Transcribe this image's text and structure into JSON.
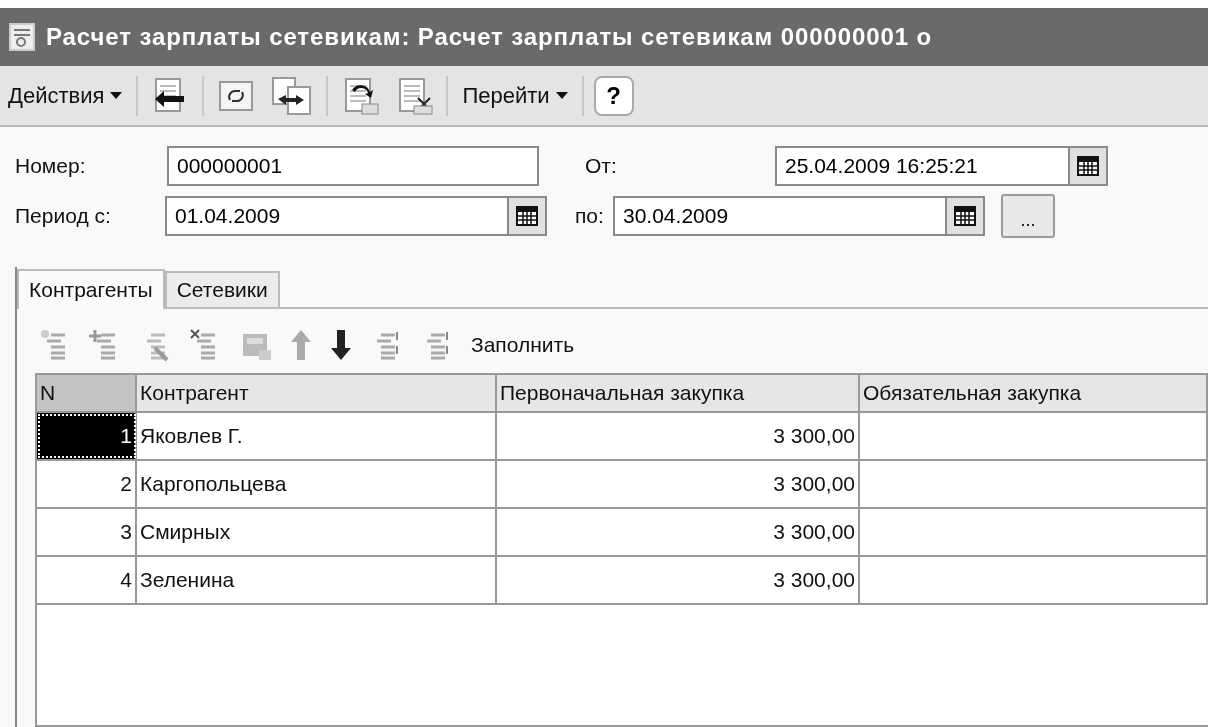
{
  "window": {
    "title": "Расчет зарплаты сетевикам: Расчет зарплаты сетевикам 000000001 о"
  },
  "toolbar": {
    "menus": [
      {
        "label": "Действия"
      },
      {
        "label": "Перейти"
      }
    ],
    "help": "?"
  },
  "header": {
    "number_label": "Номер:",
    "number": "000000001",
    "date_label": "От:",
    "date": "25.04.2009 16:25:21",
    "period_from_label": "Период с:",
    "period_from": "01.04.2009",
    "period_to_label": "по:",
    "period_to": "30.04.2009",
    "period_button": "..."
  },
  "tabs": [
    {
      "label": "Контрагенты",
      "selected": true
    },
    {
      "label": "Сетевики",
      "selected": false
    }
  ],
  "table_toolbar": {
    "fill_button": "Заполнить"
  },
  "table": {
    "columns": [
      "N",
      "Контрагент",
      "Первоначальная закупка",
      "Обязательная закупка"
    ],
    "rows": [
      {
        "n": "1",
        "name": "Яковлев Г.",
        "initial": "3 300,00",
        "selected": true
      },
      {
        "n": "2",
        "name": "Каргопольцева",
        "initial": "3 300,00",
        "selected": false
      },
      {
        "n": "3",
        "name": "Смирных",
        "initial": "3 300,00",
        "selected": false
      },
      {
        "n": "4",
        "name": "Зеленина",
        "initial": "3 300,00",
        "selected": false
      }
    ]
  }
}
